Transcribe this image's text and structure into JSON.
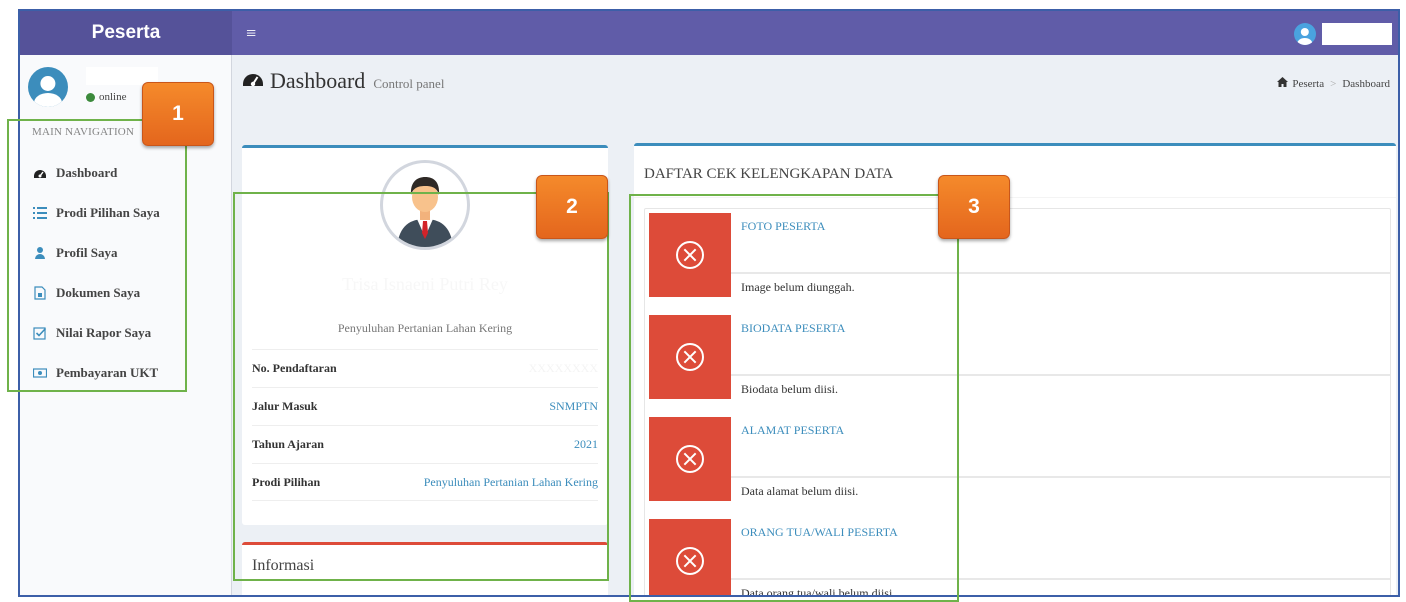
{
  "app": {
    "logo_text": "Peserta",
    "toggle_glyph": "≡"
  },
  "user": {
    "status": "online"
  },
  "sidebar": {
    "header": "MAIN NAVIGATION",
    "items": [
      {
        "label": "Dashboard",
        "icon": "dashboard-icon"
      },
      {
        "label": "Prodi Pilihan Saya",
        "icon": "list-icon"
      },
      {
        "label": "Profil Saya",
        "icon": "user-icon"
      },
      {
        "label": "Dokumen Saya",
        "icon": "file-icon"
      },
      {
        "label": "Nilai Rapor Saya",
        "icon": "check-square-icon"
      },
      {
        "label": "Pembayaran UKT",
        "icon": "money-icon"
      }
    ]
  },
  "content_header": {
    "title": "Dashboard",
    "subtitle": "Control panel",
    "breadcrumb": [
      "Peserta",
      "Dashboard"
    ],
    "breadcrumb_sep": ">"
  },
  "profile": {
    "name": "Trisa Isnaeni Putri Rey",
    "prodi": "Penyuluhan Pertanian Lahan Kering",
    "fields": [
      {
        "label": "No. Pendaftaran",
        "value": "XXXXXXXX",
        "hidden": true
      },
      {
        "label": "Jalur Masuk",
        "value": "SNMPTN"
      },
      {
        "label": "Tahun Ajaran",
        "value": "2021"
      },
      {
        "label": "Prodi Pilihan",
        "value": "Penyuluhan Pertanian Lahan Kering"
      }
    ]
  },
  "info_box": {
    "title": "Informasi"
  },
  "checklist": {
    "title": "DAFTAR CEK KELENGKAPAN DATA",
    "items": [
      {
        "title": "FOTO PESERTA",
        "desc": "Image belum diunggah."
      },
      {
        "title": "BIODATA PESERTA",
        "desc": "Biodata belum diisi."
      },
      {
        "title": "ALAMAT PESERTA",
        "desc": "Data alamat belum diisi."
      },
      {
        "title": "ORANG TUA/WALI PESERTA",
        "desc": "Data orang tua/wali belum diisi."
      }
    ]
  },
  "annotations": {
    "badges": [
      "1",
      "2",
      "3"
    ]
  },
  "colors": {
    "header": "#605ca8",
    "logo": "#555299",
    "accent": "#3c8dbc",
    "danger": "#dd4b39",
    "annotation_border": "#6fb24a",
    "badge": "#f07a24"
  }
}
